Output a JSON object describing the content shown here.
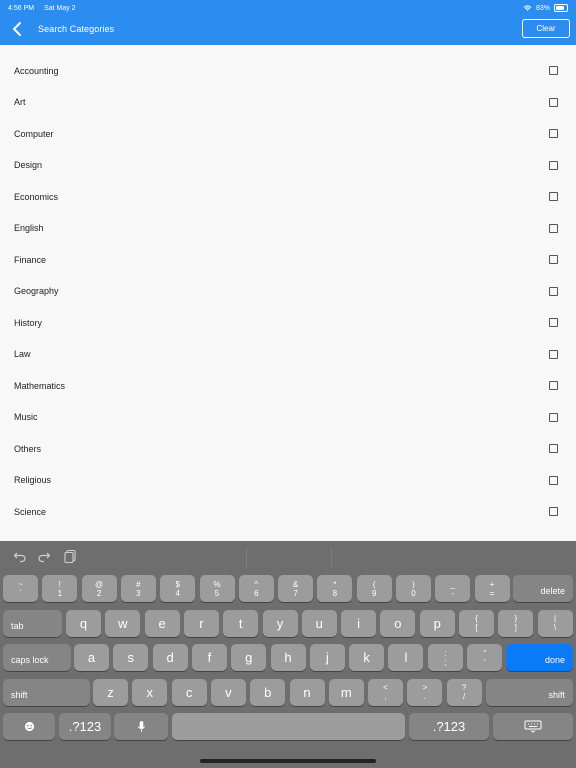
{
  "status": {
    "time": "4:56 PM",
    "date": "Sat May 2",
    "battery": "83%"
  },
  "header": {
    "title": "Search Categories",
    "clear_label": "Clear"
  },
  "categories": [
    {
      "label": "Accounting"
    },
    {
      "label": "Art"
    },
    {
      "label": "Computer"
    },
    {
      "label": "Design"
    },
    {
      "label": "Economics"
    },
    {
      "label": "English"
    },
    {
      "label": "Finance"
    },
    {
      "label": "Geography"
    },
    {
      "label": "History"
    },
    {
      "label": "Law"
    },
    {
      "label": "Mathematics"
    },
    {
      "label": "Music"
    },
    {
      "label": "Others"
    },
    {
      "label": "Religious"
    },
    {
      "label": "Science"
    }
  ],
  "keyboard": {
    "toolbar_icons": [
      "undo-icon",
      "redo-icon",
      "paste-icon"
    ],
    "numrow": [
      [
        "~",
        "`"
      ],
      [
        "!",
        "1"
      ],
      [
        "@",
        "2"
      ],
      [
        "#",
        "3"
      ],
      [
        "$",
        "4"
      ],
      [
        "%",
        "5"
      ],
      [
        "^",
        "6"
      ],
      [
        "&",
        "7"
      ],
      [
        "*",
        "8"
      ],
      [
        "(",
        "9"
      ],
      [
        ")",
        "0"
      ],
      [
        "_",
        "-"
      ],
      [
        "+",
        "="
      ]
    ],
    "delete_label": "delete",
    "tab_label": "tab",
    "qrow": [
      "q",
      "w",
      "e",
      "r",
      "t",
      "y",
      "u",
      "i",
      "o",
      "p"
    ],
    "qrow_extra": [
      [
        "{",
        "["
      ],
      [
        "}",
        "]"
      ],
      [
        "|",
        "\\"
      ]
    ],
    "caps_label": "caps lock",
    "arow": [
      "a",
      "s",
      "d",
      "f",
      "g",
      "h",
      "j",
      "k",
      "l"
    ],
    "arow_extra": [
      [
        ":",
        ";"
      ],
      [
        "\"",
        "'"
      ]
    ],
    "done_label": "done",
    "shift_label": "shift",
    "zrow": [
      "z",
      "x",
      "c",
      "v",
      "b",
      "n",
      "m"
    ],
    "zrow_extra": [
      [
        "<",
        ","
      ],
      [
        ">",
        "."
      ],
      [
        "?",
        "/"
      ]
    ],
    "numbers_label": ".?123",
    "bottom_icons": [
      "emoji-icon",
      "microphone-icon",
      "keyboard-hide-icon"
    ]
  }
}
